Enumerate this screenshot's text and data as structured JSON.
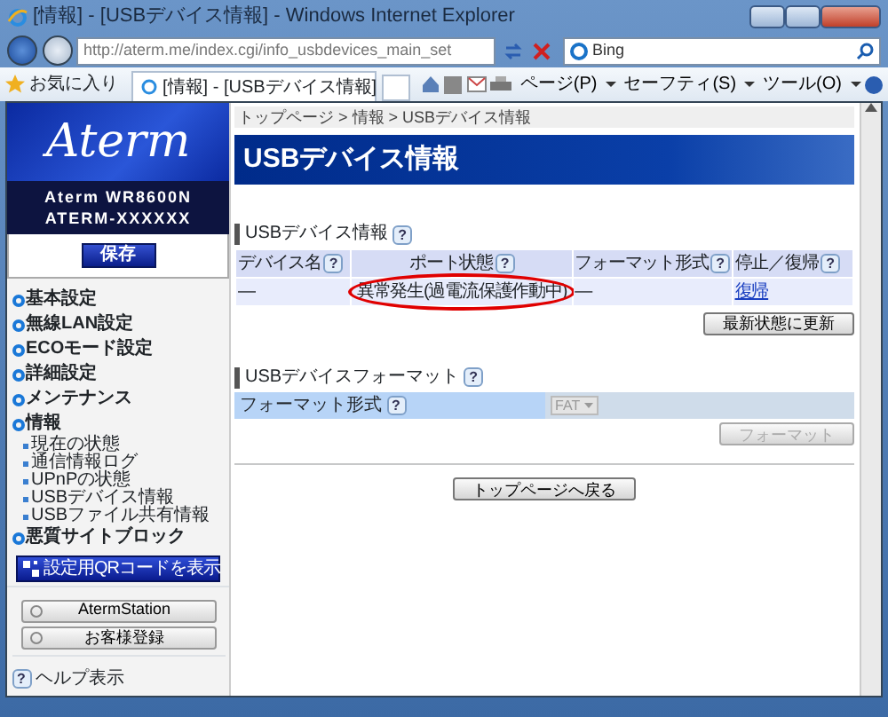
{
  "browser": {
    "title": "[情報] - [USBデバイス情報] - Windows Internet Explorer",
    "address": "http://aterm.me/index.cgi/info_usbdevices_main_set",
    "search_placeholder": "Bing",
    "favorites": "お気に入り",
    "tab_title": "[情報] - [USBデバイス情報]",
    "menus": [
      "ページ(P)",
      "セーフティ(S)",
      "ツール(O)"
    ]
  },
  "sidebar": {
    "logo": "Aterm",
    "model": "Aterm WR8600N",
    "device": "ATERM-XXXXXX",
    "save_button": "保存",
    "menu": [
      {
        "label": "基本設定"
      },
      {
        "label": "無線LAN設定"
      },
      {
        "label": "ECOモード設定"
      },
      {
        "label": "詳細設定"
      },
      {
        "label": "メンテナンス"
      },
      {
        "label": "情報",
        "children": [
          {
            "label": "現在の状態"
          },
          {
            "label": "通信情報ログ"
          },
          {
            "label": "UPnPの状態"
          },
          {
            "label": "USBデバイス情報"
          },
          {
            "label": "USBファイル共有情報"
          }
        ]
      },
      {
        "label": "悪質サイトブロック"
      }
    ],
    "qr_button": "設定用QRコードを表示",
    "links": [
      "AtermStation",
      "お客様登録"
    ],
    "help": {
      "mark": "?",
      "label": "ヘルプ表示"
    }
  },
  "main": {
    "breadcrumb": "トップページ > 情報 > USBデバイス情報",
    "title": "USBデバイス情報",
    "device_section": {
      "title": "USBデバイス情報",
      "help": "?",
      "columns": [
        {
          "label": "デバイス名",
          "help": "?"
        },
        {
          "label": "ポート状態",
          "help": "?"
        },
        {
          "label": "フォーマット形式",
          "help": "?"
        },
        {
          "label": "停止／復帰",
          "help": "?"
        }
      ],
      "rows": [
        [
          {
            "text": "—",
            "kind": "text",
            "circled": false
          },
          {
            "text": "異常発生(過電流保護作動中)",
            "kind": "text",
            "circled": true
          },
          {
            "text": "—",
            "kind": "text",
            "circled": false
          },
          {
            "text": "復帰",
            "kind": "link",
            "circled": false
          }
        ]
      ],
      "refresh_button": "最新状態に更新"
    },
    "format_section": {
      "title": "USBデバイスフォーマット",
      "help": "?",
      "field_label": "フォーマット形式",
      "field_help": "?",
      "select_value": "FAT",
      "select_disabled": true,
      "format_button": "フォーマット",
      "format_disabled": true
    },
    "back_button": "トップページへ戻る"
  }
}
